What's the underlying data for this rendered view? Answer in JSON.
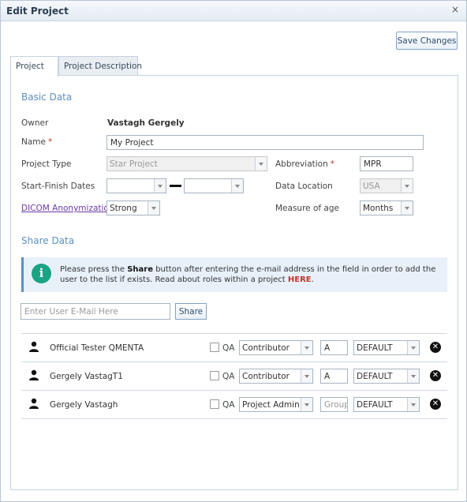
{
  "dialog": {
    "title": "Edit Project",
    "close_label": "×"
  },
  "toolbar": {
    "save_label": "Save Changes"
  },
  "tabs": [
    {
      "label": "Project",
      "active": true
    },
    {
      "label": "Project Description",
      "active": false
    }
  ],
  "basic": {
    "section_title": "Basic Data",
    "owner_label": "Owner",
    "owner_value": "Vastagh Gergely",
    "name_label": "Name",
    "name_value": "My Project",
    "required_mark": "*",
    "project_type_label": "Project Type",
    "project_type_value": "Star Project",
    "abbreviation_label": "Abbreviation",
    "abbreviation_value": "MPR",
    "dates_label": "Start-Finish Dates",
    "start_date_value": "",
    "finish_date_value": "",
    "data_location_label": "Data Location",
    "data_location_value": "USA",
    "dicom_link": "DICOM Anonymization",
    "dicom_value": "Strong",
    "measure_label": "Measure of age",
    "measure_value": "Months"
  },
  "share": {
    "section_title": "Share Data",
    "info_pre": "Please press the ",
    "info_bold": "Share",
    "info_mid": " button after entering the e-mail address in the field in order to add the user to the list if exists. Read about roles within a project ",
    "info_link": "HERE",
    "info_end": ".",
    "email_placeholder": "Enter User E-Mail Here",
    "share_button": "Share",
    "users": [
      {
        "name": "Official Tester QMENTA",
        "qa_label": "QA",
        "qa_checked": false,
        "role": "Contributor",
        "group": "A",
        "group_placeholder": "",
        "site": "DEFAULT"
      },
      {
        "name": "Gergely VastagT1",
        "qa_label": "QA",
        "qa_checked": false,
        "role": "Contributor",
        "group": "A",
        "group_placeholder": "",
        "site": "DEFAULT"
      },
      {
        "name": "Gergely Vastagh",
        "qa_label": "QA",
        "qa_checked": false,
        "role": "Project Admin",
        "group": "",
        "group_placeholder": "Group",
        "site": "DEFAULT"
      }
    ]
  },
  "icons": {
    "user": "user-icon",
    "remove": "remove-circle-icon",
    "info": "info-icon",
    "close": "close-icon",
    "dropdown": "chevron-down-icon"
  },
  "colors": {
    "accent": "#5c8fc1",
    "info_icon": "#1aa384",
    "required": "#c0392b",
    "link": "#6a3aa6"
  }
}
